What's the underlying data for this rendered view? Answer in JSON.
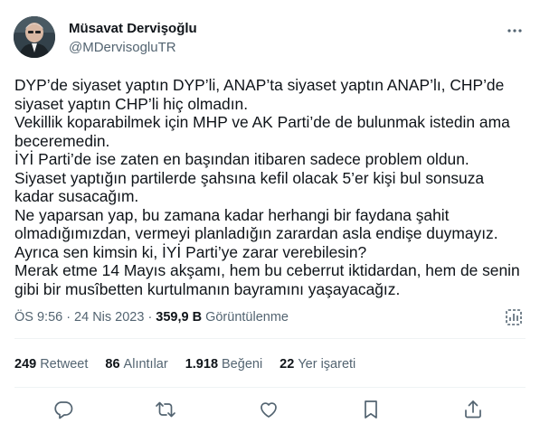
{
  "author": {
    "name": "Müsavat Dervişoğlu",
    "handle": "@MDervisogluTR"
  },
  "tweet": {
    "lines": [
      "DYP’de siyaset yaptın DYP’li, ANAP’ta siyaset yaptın ANAP’lı, CHP’de",
      "siyaset yaptın CHP’li hiç olmadın.",
      "Vekillik koparabilmek için MHP ve AK Parti’de de bulunmak istedin ama",
      "beceremedin.",
      "İYİ Parti’de ise zaten en başından itibaren sadece problem oldun.",
      "Siyaset yaptığın partilerde şahsına kefil olacak 5’er kişi bul sonsuza",
      "kadar susacağım.",
      "Ne yaparsan yap, bu zamana kadar herhangi bir faydana şahit",
      "olmadığımızdan, vermeyi planladığın zarardan asla endişe duymayız.",
      "Ayrıca sen kimsin ki, İYİ Parti’ye zarar verebilesin?",
      "Merak etme 14 Mayıs akşamı, hem bu ceberrut iktidardan, hem de senin",
      "gibi bir musîbetten kurtulmanın bayramını yaşayacağız."
    ]
  },
  "meta": {
    "time": "ÖS 9:56",
    "separator": "·",
    "date": "24 Nis 2023",
    "views_count": "359,9 B",
    "views_label": "Görüntülenme"
  },
  "stats": {
    "retweets": {
      "count": "249",
      "label": "Retweet"
    },
    "quotes": {
      "count": "86",
      "label": "Alıntılar"
    },
    "likes": {
      "count": "1.918",
      "label": "Beğeni"
    },
    "bookmarks": {
      "count": "22",
      "label": "Yer işareti"
    }
  },
  "icons": {
    "more": "more-dots-icon",
    "analytics": "analytics-icon",
    "reply": "reply-icon",
    "retweet": "retweet-icon",
    "like": "heart-icon",
    "bookmark": "bookmark-icon",
    "share": "share-icon"
  },
  "colors": {
    "text": "#0f1419",
    "secondary": "#536471",
    "divider": "#eff3f4"
  }
}
